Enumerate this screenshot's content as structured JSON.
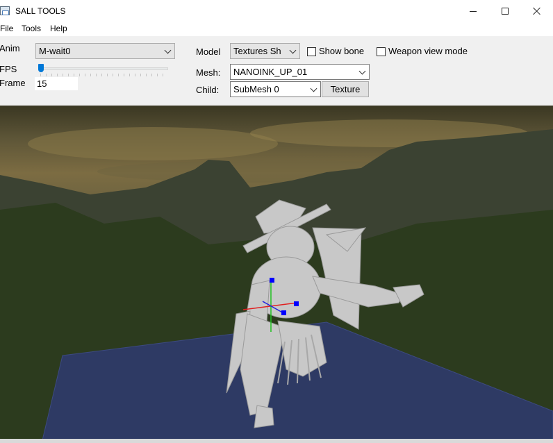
{
  "window": {
    "title": "SALL TOOLS",
    "icon": "app-window-icon",
    "controls": [
      "minimize-icon",
      "maximize-icon",
      "close-icon"
    ]
  },
  "menu": {
    "file": "File",
    "tools": "Tools",
    "help": "Help"
  },
  "controls": {
    "anim_label": "Anim",
    "anim_value": "M-wait0",
    "fps_label": "FPS",
    "fps_slider_fraction": 0.02,
    "frame_label": "Frame",
    "frame_value": "15",
    "model_label": "Model",
    "model_value": "Textures Sh",
    "show_bone_label": "Show bone",
    "show_bone_checked": false,
    "weapon_view_label": "Weapon view mode",
    "weapon_view_checked": false,
    "mesh_label": "Mesh:",
    "mesh_value": "NANOINK_UP_01",
    "child_label": "Child:",
    "child_value": "SubMesh 0",
    "texture_button": "Texture"
  },
  "viewport": {
    "description_icons": [
      "skybox-mountains",
      "ground-plane",
      "character-model",
      "gizmo-axes"
    ],
    "colors": {
      "ground_plane": "#2a3a6a",
      "model": "#c8c8c8",
      "axis_x": "#e02020",
      "axis_y": "#20c020",
      "axis_z": "#2020e0",
      "gizmo_handle": "#0000ff"
    }
  }
}
